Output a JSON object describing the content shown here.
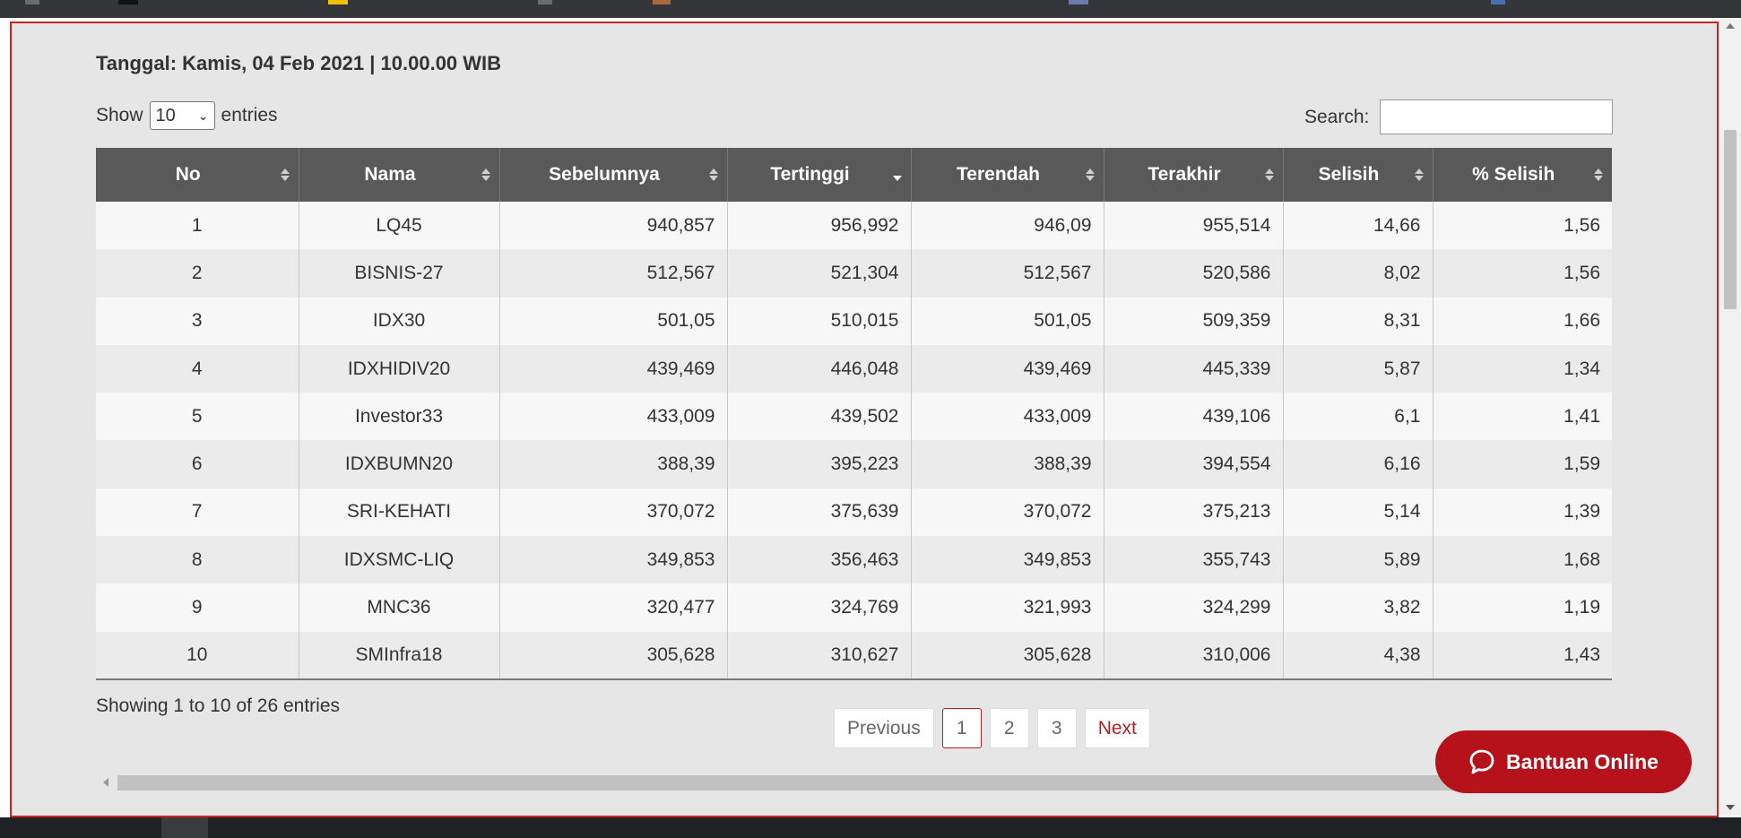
{
  "header": {
    "date_line": "Tanggal: Kamis, 04 Feb 2021 | 10.00.00 WIB"
  },
  "length_control": {
    "prefix": "Show",
    "selected": "10",
    "suffix": "entries"
  },
  "search": {
    "label": "Search:",
    "value": ""
  },
  "table": {
    "columns": [
      "No",
      "Nama",
      "Sebelumnya",
      "Tertinggi",
      "Terendah",
      "Terakhir",
      "Selisih",
      "% Selisih"
    ],
    "sorted_column": "Tertinggi",
    "sort_direction": "desc",
    "rows": [
      [
        "1",
        "LQ45",
        "940,857",
        "956,992",
        "946,09",
        "955,514",
        "14,66",
        "1,56"
      ],
      [
        "2",
        "BISNIS-27",
        "512,567",
        "521,304",
        "512,567",
        "520,586",
        "8,02",
        "1,56"
      ],
      [
        "3",
        "IDX30",
        "501,05",
        "510,015",
        "501,05",
        "509,359",
        "8,31",
        "1,66"
      ],
      [
        "4",
        "IDXHIDIV20",
        "439,469",
        "446,048",
        "439,469",
        "445,339",
        "5,87",
        "1,34"
      ],
      [
        "5",
        "Investor33",
        "433,009",
        "439,502",
        "433,009",
        "439,106",
        "6,1",
        "1,41"
      ],
      [
        "6",
        "IDXBUMN20",
        "388,39",
        "395,223",
        "388,39",
        "394,554",
        "6,16",
        "1,59"
      ],
      [
        "7",
        "SRI-KEHATI",
        "370,072",
        "375,639",
        "370,072",
        "375,213",
        "5,14",
        "1,39"
      ],
      [
        "8",
        "IDXSMC-LIQ",
        "349,853",
        "356,463",
        "349,853",
        "355,743",
        "5,89",
        "1,68"
      ],
      [
        "9",
        "MNC36",
        "320,477",
        "324,769",
        "321,993",
        "324,299",
        "3,82",
        "1,19"
      ],
      [
        "10",
        "SMInfra18",
        "305,628",
        "310,627",
        "305,628",
        "310,006",
        "4,38",
        "1,43"
      ]
    ]
  },
  "info": "Showing 1 to 10 of 26 entries",
  "pagination": {
    "previous": "Previous",
    "pages": [
      "1",
      "2",
      "3"
    ],
    "current": "1",
    "next": "Next"
  },
  "help_button": {
    "label": "Bantuan Online",
    "icon": "chat-bubble-icon"
  },
  "colors": {
    "header_bg": "#595959",
    "accent_red": "#b5121b",
    "frame_border": "#cc2222",
    "panel_bg": "#e6e6e6"
  }
}
